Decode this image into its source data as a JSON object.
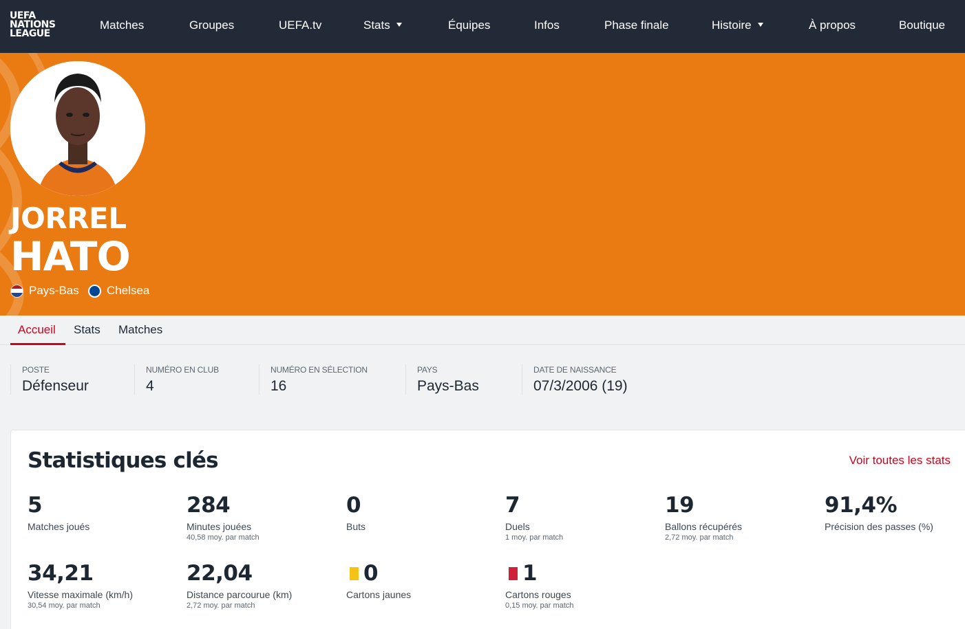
{
  "nav": {
    "logo_lines": [
      "UEFA",
      "NATIONS",
      "LEAGUE"
    ],
    "items": [
      {
        "label": "Matches"
      },
      {
        "label": "Groupes"
      },
      {
        "label": "UEFA.tv"
      },
      {
        "label": "Stats",
        "dropdown": true
      },
      {
        "label": "Équipes"
      },
      {
        "label": "Infos"
      },
      {
        "label": "Phase finale"
      },
      {
        "label": "Histoire",
        "dropdown": true
      },
      {
        "label": "À propos"
      },
      {
        "label": "Boutique"
      }
    ]
  },
  "player": {
    "first_name": "JORREL",
    "last_name": "HATO",
    "country": "Pays-Bas",
    "club": "Chelsea",
    "accent_color": "#ea7a12"
  },
  "tabs": [
    {
      "label": "Accueil",
      "active": true
    },
    {
      "label": "Stats",
      "active": false
    },
    {
      "label": "Matches",
      "active": false
    }
  ],
  "info": [
    {
      "label": "POSTE",
      "value": "Défenseur"
    },
    {
      "label": "NUMÉRO EN CLUB",
      "value": "4"
    },
    {
      "label": "NUMÉRO EN SÉLECTION",
      "value": "16"
    },
    {
      "label": "PAYS",
      "value": "Pays-Bas"
    },
    {
      "label": "DATE DE NAISSANCE",
      "value": "07/3/2006 (19)"
    }
  ],
  "stats": {
    "title": "Statistiques clés",
    "link": "Voir toutes les stats",
    "items": [
      {
        "value": "5",
        "label": "Matches joués",
        "sub": ""
      },
      {
        "value": "284",
        "label": "Minutes jouées",
        "sub": "40,58 moy. par match"
      },
      {
        "value": "0",
        "label": "Buts",
        "sub": ""
      },
      {
        "value": "7",
        "label": "Duels",
        "sub": "1 moy. par match"
      },
      {
        "value": "19",
        "label": "Ballons récupérés",
        "sub": "2,72 moy. par match"
      },
      {
        "value": "91,4%",
        "label": "Précision des passes (%)",
        "sub": ""
      },
      {
        "value": "34,21",
        "label": "Vitesse maximale (km/h)",
        "sub": "30,54 moy. par match"
      },
      {
        "value": "22,04",
        "label": "Distance parcourue (km)",
        "sub": "2,72 moy. par match"
      },
      {
        "value": "0",
        "label": "Cartons jaunes",
        "sub": ""
      },
      {
        "value": "1",
        "label": "Cartons rouges",
        "sub": "0,15 moy. par match"
      }
    ]
  },
  "colors": {
    "nav_bg": "#222a37",
    "hero_bg": "#ea7a12",
    "link_red": "#d0021b",
    "yellow_card": "#f5c316",
    "red_card": "#d0213b"
  }
}
